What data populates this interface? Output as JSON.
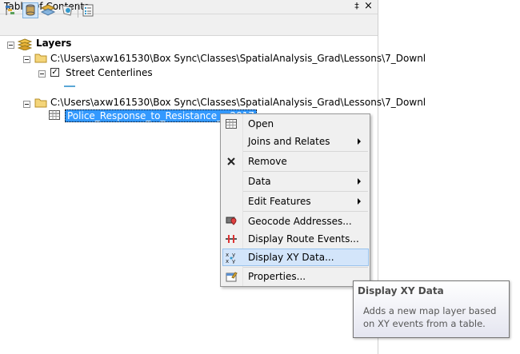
{
  "panel": {
    "title": "Table Of Contents",
    "pin_glyph": "‡",
    "close_glyph": "×"
  },
  "toolbar": {
    "buttons": [
      "list-by-drawing-order-icon",
      "list-by-source-icon",
      "list-by-visibility-icon",
      "list-by-selection-icon",
      "options-icon"
    ]
  },
  "tree": {
    "root": {
      "label": "Layers",
      "icon": "layers-icon"
    },
    "groups": [
      {
        "path": "C:\\Users\\axw161530\\Box Sync\\Classes\\SpatialAnalysis_Grad\\Lessons\\7_Downl",
        "items": [
          {
            "label": "Street Centerlines",
            "checked": true,
            "symbol_color": "#5aa7d6"
          }
        ]
      },
      {
        "path": "C:\\Users\\axw161530\\Box Sync\\Classes\\SpatialAnalysis_Grad\\Lessons\\7_Downl",
        "items": [
          {
            "label": "Police_Response_to_Resistance_-_2017",
            "selected": true
          }
        ]
      }
    ]
  },
  "context_menu": {
    "items": [
      {
        "label": "Open",
        "icon": "table-icon",
        "submenu": false
      },
      {
        "label": "Joins and Relates",
        "icon": "",
        "submenu": true
      },
      {
        "label": "Remove",
        "icon": "remove-x-icon",
        "submenu": false
      },
      {
        "label": "Data",
        "icon": "",
        "submenu": true
      },
      {
        "label": "Edit Features",
        "icon": "",
        "submenu": true
      },
      {
        "label": "Geocode Addresses...",
        "icon": "geocode-icon",
        "submenu": false
      },
      {
        "label": "Display Route Events...",
        "icon": "route-events-icon",
        "submenu": false
      },
      {
        "label": "Display XY Data...",
        "icon": "xy-data-icon",
        "submenu": false,
        "highlighted": true
      },
      {
        "label": "Properties...",
        "icon": "properties-icon",
        "submenu": false
      }
    ]
  },
  "tooltip": {
    "title": "Display XY Data",
    "body": "Adds a new map layer based on XY events from a table."
  },
  "colors": {
    "selection": "#3399ff",
    "menu_highlight": "#d3e5fa",
    "folder": "#e8c15a"
  }
}
